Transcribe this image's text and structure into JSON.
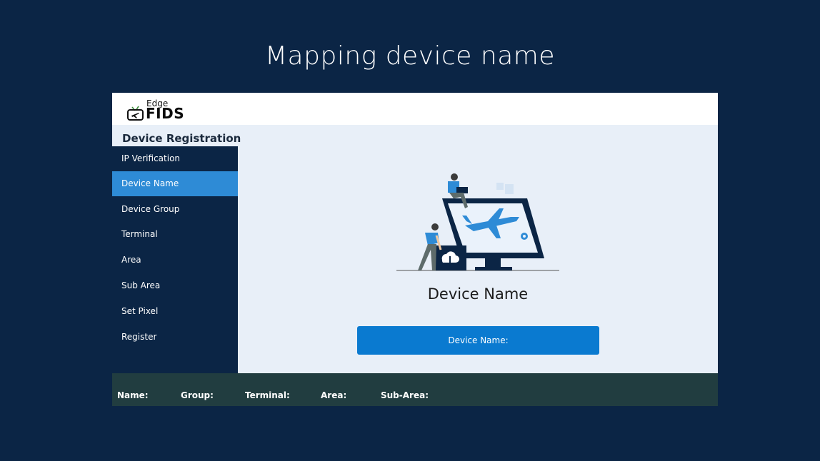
{
  "slide": {
    "title": "Mapping device name"
  },
  "logo": {
    "top_text": "Edge",
    "main_text": "FIDS"
  },
  "section": {
    "title": "Device Registration"
  },
  "sidebar": {
    "items": [
      {
        "label": "IP Verification",
        "active": false
      },
      {
        "label": "Device Name",
        "active": true
      },
      {
        "label": "Device Group",
        "active": false
      },
      {
        "label": "Terminal",
        "active": false
      },
      {
        "label": "Area",
        "active": false
      },
      {
        "label": "Sub Area",
        "active": false
      },
      {
        "label": "Set Pixel",
        "active": false
      },
      {
        "label": "Register",
        "active": false
      }
    ]
  },
  "main": {
    "heading": "Device Name",
    "field_label": "Device Name:",
    "illustration": "airport-display-illustration-icon"
  },
  "footer": {
    "name_label": "Name:",
    "group_label": "Group:",
    "terminal_label": "Terminal:",
    "area_label": "Area:",
    "subarea_label": "Sub-Area:"
  },
  "colors": {
    "background": "#0b2545",
    "sidebar": "#0b2545",
    "active_item": "#2e8bd6",
    "content_bg": "#e8eff8",
    "field": "#0a7ad0",
    "footer": "#213d40"
  }
}
